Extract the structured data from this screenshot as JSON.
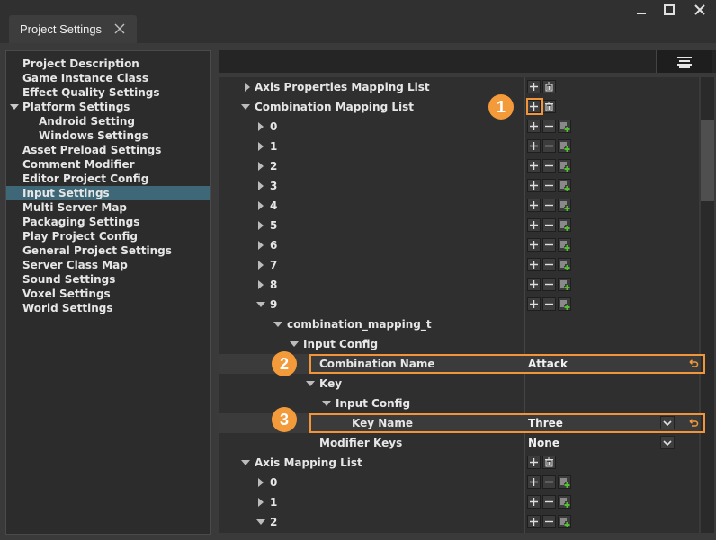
{
  "window": {
    "tab_label": "Project Settings",
    "controls": [
      "minimize-icon",
      "maximize-icon",
      "close-icon"
    ]
  },
  "sidebar": {
    "items": [
      {
        "label": "Project Description"
      },
      {
        "label": "Game Instance Class"
      },
      {
        "label": "Effect Quality Settings"
      },
      {
        "label": "Platform Settings",
        "expanded": true
      },
      {
        "label": "Android Setting",
        "child": true
      },
      {
        "label": "Windows Settings",
        "child": true
      },
      {
        "label": "Asset Preload Settings"
      },
      {
        "label": "Comment Modifier"
      },
      {
        "label": "Editor Project Config"
      },
      {
        "label": "Input Settings",
        "selected": true
      },
      {
        "label": "Multi Server Map"
      },
      {
        "label": "Packaging Settings"
      },
      {
        "label": "Play Project Config"
      },
      {
        "label": "General Project Settings"
      },
      {
        "label": "Server Class Map"
      },
      {
        "label": "Sound Settings"
      },
      {
        "label": "Voxel Settings"
      },
      {
        "label": "World Settings"
      }
    ]
  },
  "details": {
    "menu_icon": "hamburger-icon",
    "rows": [
      {
        "label": "Axis Properties Mapping List",
        "arrow": "right",
        "controls": [
          "add",
          "delete"
        ]
      },
      {
        "label": "Combination Mapping List",
        "arrow": "down",
        "controls": [
          "add",
          "delete"
        ]
      },
      {
        "label": "0",
        "arrow": "right",
        "controls": [
          "add",
          "remove",
          "duplicate"
        ]
      },
      {
        "label": "1",
        "arrow": "right",
        "controls": [
          "add",
          "remove",
          "duplicate"
        ]
      },
      {
        "label": "2",
        "arrow": "right",
        "controls": [
          "add",
          "remove",
          "duplicate"
        ]
      },
      {
        "label": "3",
        "arrow": "right",
        "controls": [
          "add",
          "remove",
          "duplicate"
        ]
      },
      {
        "label": "4",
        "arrow": "right",
        "controls": [
          "add",
          "remove",
          "duplicate"
        ]
      },
      {
        "label": "5",
        "arrow": "right",
        "controls": [
          "add",
          "remove",
          "duplicate"
        ]
      },
      {
        "label": "6",
        "arrow": "right",
        "controls": [
          "add",
          "remove",
          "duplicate"
        ]
      },
      {
        "label": "7",
        "arrow": "right",
        "controls": [
          "add",
          "remove",
          "duplicate"
        ]
      },
      {
        "label": "8",
        "arrow": "right",
        "controls": [
          "add",
          "remove",
          "duplicate"
        ]
      },
      {
        "label": "9",
        "arrow": "down",
        "controls": [
          "add",
          "remove",
          "duplicate"
        ]
      },
      {
        "label": "combination_mapping_t",
        "arrow": "down"
      },
      {
        "label": "Input Config",
        "arrow": "down"
      },
      {
        "label": "Combination Name",
        "value": "Attack",
        "reset": true
      },
      {
        "label": "Key",
        "arrow": "down"
      },
      {
        "label": "Input Config",
        "arrow": "down"
      },
      {
        "label": "Key Name",
        "value": "Three",
        "dropdown": true,
        "reset": true
      },
      {
        "label": "Modifier Keys",
        "value": "None",
        "dropdown": true
      },
      {
        "label": "Axis Mapping List",
        "arrow": "down",
        "controls": [
          "add",
          "delete"
        ]
      },
      {
        "label": "0",
        "arrow": "right",
        "controls": [
          "add",
          "remove",
          "duplicate"
        ]
      },
      {
        "label": "1",
        "arrow": "right",
        "controls": [
          "add",
          "remove",
          "duplicate"
        ]
      },
      {
        "label": "2",
        "arrow": "down",
        "controls": [
          "add",
          "remove",
          "duplicate"
        ]
      }
    ]
  },
  "callouts": [
    {
      "number": "1",
      "target": "add-combination-mapping-button"
    },
    {
      "number": "2",
      "target": "combination-name-row"
    },
    {
      "number": "3",
      "target": "key-name-row"
    }
  ],
  "colors": {
    "accent_orange": "#f39a3b",
    "selection": "#3e6777",
    "duplicate_icon_green": "#55c030"
  }
}
